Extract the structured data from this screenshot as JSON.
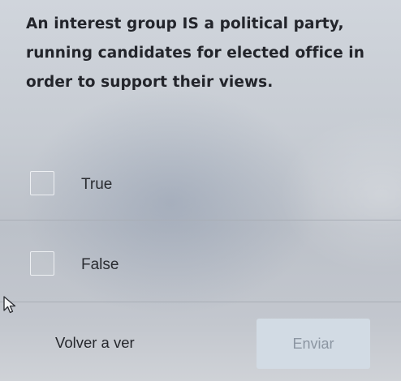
{
  "question": {
    "text": "An interest group IS a political party, running candidates for elected office in order to support their views."
  },
  "options": [
    {
      "label": "True",
      "checked": false
    },
    {
      "label": "False",
      "checked": false
    }
  ],
  "actions": {
    "back_label": "Volver a ver",
    "submit_label": "Enviar",
    "submit_enabled": false
  },
  "colors": {
    "submit_background": "#d2dbe4",
    "submit_text": "#8c96a2",
    "checkbox_border": "#eef0f3"
  },
  "icons": {
    "cursor": "mouse-pointer-icon"
  }
}
